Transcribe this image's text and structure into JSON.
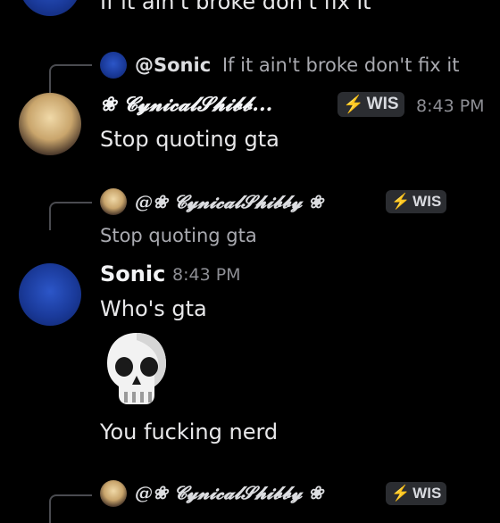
{
  "top_message": {
    "text": "If it ain't broke don't fix it"
  },
  "message1": {
    "reply": {
      "author": "@Sonic",
      "text": "If it ain't broke don't fix it"
    },
    "author": "❀ 𝓒𝔂𝓷𝓲𝓬𝓪𝓵𝓢𝓱𝓲𝓫𝓫...",
    "badge": "WIS",
    "time": "8:43 PM",
    "text": "Stop quoting gta"
  },
  "message2": {
    "reply": {
      "author": "@❀ 𝓒𝔂𝓷𝓲𝓬𝓪𝓵𝓢𝓱𝓲𝓫𝓫𝔂 ❀",
      "badge": "WIS",
      "text": "Stop quoting gta"
    },
    "author": "Sonic",
    "time": "8:43 PM",
    "text": "Who's gta",
    "emoji": "skull-emoji",
    "text2": "You fucking nerd"
  },
  "message3": {
    "reply": {
      "author": "@❀ 𝓒𝔂𝓷𝓲𝓬𝓪𝓵𝓢𝓱𝓲𝓫𝓫𝔂 ❀",
      "badge": "WIS"
    }
  },
  "icons": {
    "badge": "lightning-bolt-icon"
  },
  "colors": {
    "background": "#000000",
    "badge_accent": "#b586ff",
    "text": "#e8e8ea",
    "muted": "#8d8e94"
  }
}
